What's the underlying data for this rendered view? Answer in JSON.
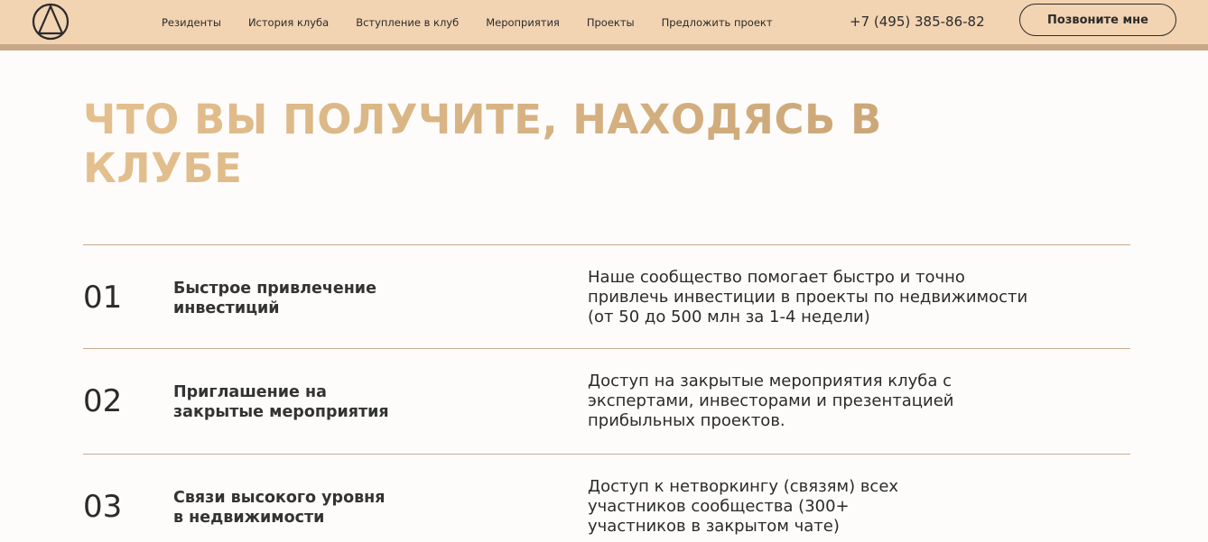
{
  "header": {
    "logo_icon": "triangle-in-circle-logo",
    "nav": [
      {
        "label": "Резиденты"
      },
      {
        "label": "История клуба"
      },
      {
        "label": "Вступление в клуб"
      },
      {
        "label": "Мероприятия"
      },
      {
        "label": "Проекты"
      },
      {
        "label": "Предложить проект"
      }
    ],
    "phone": "+7 (495) 385-86-82",
    "call_button": "Позвоните мне",
    "colors": {
      "background": "#f2d3b2",
      "border": "#c9a789"
    }
  },
  "main": {
    "title_line1": "ЧТО ВЫ ПОЛУЧИТЕ, НАХОДЯСЬ В",
    "title_line2": "КЛУБЕ",
    "title_color": "#d8b687",
    "benefits": [
      {
        "number": "01",
        "title_line1": "Быстрое привлечение",
        "title_line2": "инвестиций",
        "desc_line1": "Наше сообщество помогает быстро и точно",
        "desc_line2": "привлечь инвестиции в проекты по недвижимости",
        "desc_line3": "(от 50 до 500 млн за 1-4 недели)"
      },
      {
        "number": "02",
        "title_line1": "Приглашение на",
        "title_line2": "закрытые мероприятия",
        "desc_line1": "Доступ на закрытые мероприятия клуба с",
        "desc_line2": "экспертами, инвесторами и презентацией",
        "desc_line3": "прибыльных проектов."
      },
      {
        "number": "03",
        "title_line1": "Связи высокого уровня",
        "title_line2": "в недвижимости",
        "desc_line1": "Доступ к нетворкингу (связям) всех",
        "desc_line2": "участников сообщества (300+",
        "desc_line3": "участников в закрытом чате)"
      }
    ]
  }
}
